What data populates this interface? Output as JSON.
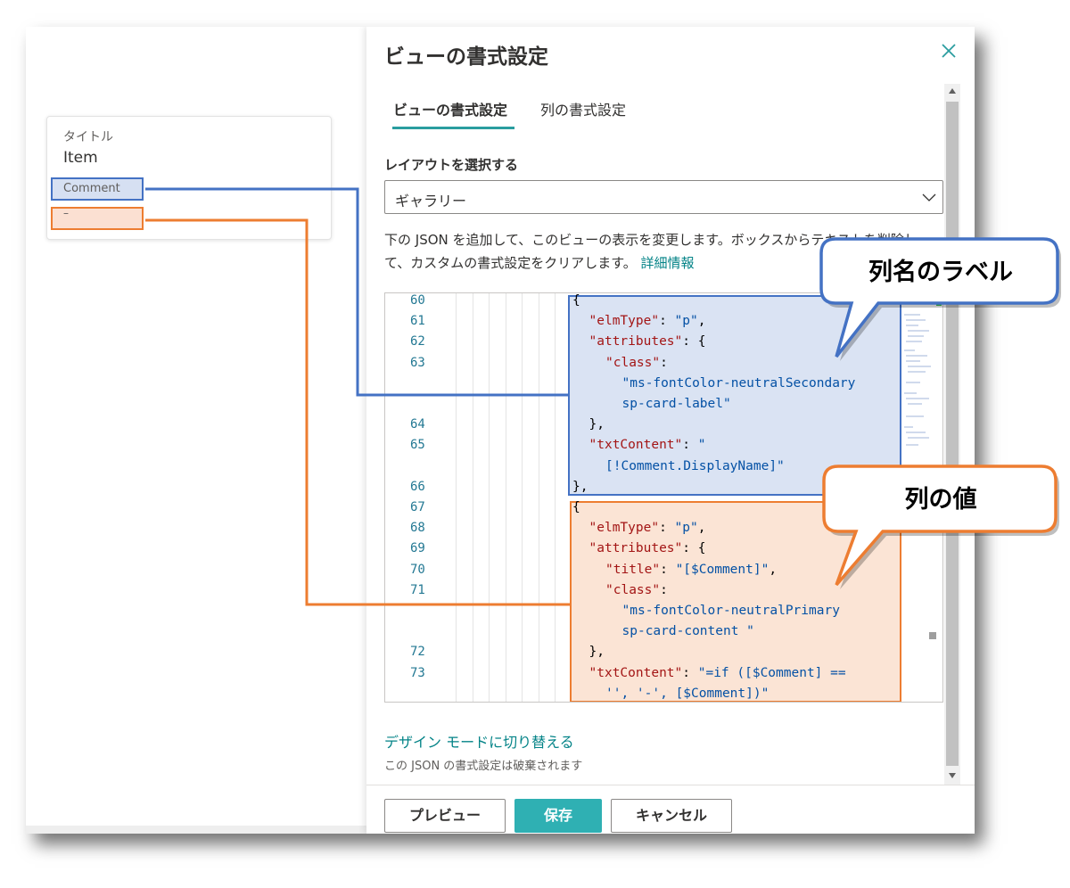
{
  "card": {
    "title_label": "タイトル",
    "title_value": "Item",
    "comment_label": "Comment",
    "comment_value": "–"
  },
  "panel": {
    "title": "ビューの書式設定",
    "tabs": [
      {
        "label": "ビューの書式設定",
        "active": true
      },
      {
        "label": "列の書式設定",
        "active": false
      }
    ],
    "layout_label": "レイアウトを選択する",
    "layout_value": "ギャラリー",
    "description": "下の JSON を追加して、このビューの表示を変更します。ボックスからテキストを削除して、カスタムの書式設定をクリアします。",
    "learn_more": "詳細情報",
    "design_mode_link": "デザイン モードに切り替える",
    "design_mode_note": "この JSON の書式設定は破棄されます",
    "buttons": {
      "preview": "プレビュー",
      "save": "保存",
      "cancel": "キャンセル"
    }
  },
  "editor": {
    "line_numbers": [
      {
        "n": "60",
        "row": 0
      },
      {
        "n": "61",
        "row": 1
      },
      {
        "n": "62",
        "row": 2
      },
      {
        "n": "63",
        "row": 3
      },
      {
        "n": "64",
        "row": 6
      },
      {
        "n": "65",
        "row": 7
      },
      {
        "n": "66",
        "row": 9
      },
      {
        "n": "67",
        "row": 10
      },
      {
        "n": "68",
        "row": 11
      },
      {
        "n": "69",
        "row": 12
      },
      {
        "n": "70",
        "row": 13
      },
      {
        "n": "71",
        "row": 14
      },
      {
        "n": "72",
        "row": 17
      },
      {
        "n": "73",
        "row": 18
      }
    ],
    "lines": [
      {
        "row": 0,
        "indent": 0,
        "parts": [
          [
            "p",
            "{"
          ]
        ]
      },
      {
        "row": 1,
        "indent": 1,
        "parts": [
          [
            "k",
            "\"elmType\""
          ],
          [
            "p",
            ": "
          ],
          [
            "s",
            "\"p\""
          ],
          [
            "p",
            ","
          ]
        ]
      },
      {
        "row": 2,
        "indent": 1,
        "parts": [
          [
            "k",
            "\"attributes\""
          ],
          [
            "p",
            ": {"
          ]
        ]
      },
      {
        "row": 3,
        "indent": 2,
        "parts": [
          [
            "k",
            "\"class\""
          ],
          [
            "p",
            ":"
          ]
        ]
      },
      {
        "row": 4,
        "indent": 3,
        "parts": [
          [
            "s",
            "\"ms-fontColor-neutralSecondary"
          ]
        ]
      },
      {
        "row": 5,
        "indent": 3,
        "parts": [
          [
            "s",
            "sp-card-label\""
          ]
        ]
      },
      {
        "row": 6,
        "indent": 1,
        "parts": [
          [
            "p",
            "},"
          ]
        ]
      },
      {
        "row": 7,
        "indent": 1,
        "parts": [
          [
            "k",
            "\"txtContent\""
          ],
          [
            "p",
            ": "
          ],
          [
            "s",
            "\""
          ]
        ]
      },
      {
        "row": 8,
        "indent": 2,
        "parts": [
          [
            "s",
            "[!Comment.DisplayName]\""
          ]
        ]
      },
      {
        "row": 9,
        "indent": 0,
        "parts": [
          [
            "p",
            "},"
          ]
        ]
      },
      {
        "row": 10,
        "indent": 0,
        "parts": [
          [
            "p",
            "{"
          ]
        ]
      },
      {
        "row": 11,
        "indent": 1,
        "parts": [
          [
            "k",
            "\"elmType\""
          ],
          [
            "p",
            ": "
          ],
          [
            "s",
            "\"p\""
          ],
          [
            "p",
            ","
          ]
        ]
      },
      {
        "row": 12,
        "indent": 1,
        "parts": [
          [
            "k",
            "\"attributes\""
          ],
          [
            "p",
            ": {"
          ]
        ]
      },
      {
        "row": 13,
        "indent": 2,
        "parts": [
          [
            "k",
            "\"title\""
          ],
          [
            "p",
            ": "
          ],
          [
            "s",
            "\"[$Comment]\""
          ],
          [
            "p",
            ","
          ]
        ]
      },
      {
        "row": 14,
        "indent": 2,
        "parts": [
          [
            "k",
            "\"class\""
          ],
          [
            "p",
            ":"
          ]
        ]
      },
      {
        "row": 15,
        "indent": 3,
        "parts": [
          [
            "s",
            "\"ms-fontColor-neutralPrimary"
          ]
        ]
      },
      {
        "row": 16,
        "indent": 3,
        "parts": [
          [
            "s",
            "sp-card-content \""
          ]
        ]
      },
      {
        "row": 17,
        "indent": 1,
        "parts": [
          [
            "p",
            "},"
          ]
        ]
      },
      {
        "row": 18,
        "indent": 1,
        "parts": [
          [
            "k",
            "\"txtContent\""
          ],
          [
            "p",
            ": "
          ],
          [
            "s",
            "\"=if ([$Comment] =="
          ]
        ]
      },
      {
        "row": 19,
        "indent": 2,
        "parts": [
          [
            "s",
            "'', '-', [$Comment])\""
          ]
        ]
      }
    ]
  },
  "callouts": {
    "label_callout": "列名のラベル",
    "value_callout": "列の値"
  },
  "colors": {
    "accent_teal": "#2fb0b3",
    "callout_blue": "#4472c4",
    "callout_orange": "#ed7d31",
    "json_key": "#a31515",
    "json_string": "#0451a5",
    "line_number": "#237893"
  }
}
